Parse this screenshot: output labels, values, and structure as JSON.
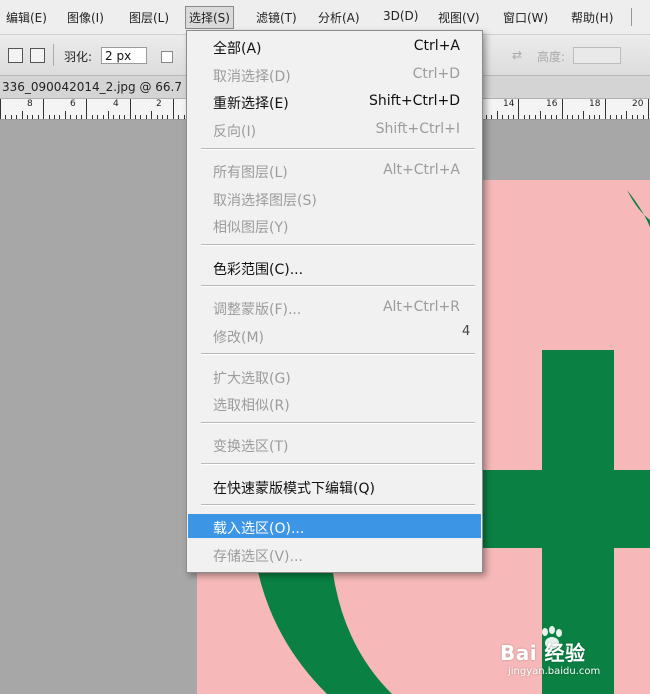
{
  "menubar": {
    "items": [
      "编辑(E)",
      "图像(I)",
      "图层(L)",
      "选择(S)",
      "滤镜(T)",
      "分析(A)",
      "3D(D)",
      "视图(V)",
      "窗口(W)",
      "帮助(H)"
    ]
  },
  "options": {
    "feather_label": "羽化:",
    "feather_value": "2 px",
    "height_label": "高度:",
    "swap_glyph": "⇄"
  },
  "document": {
    "tab_title": "336_090042014_2.jpg @ 66.7"
  },
  "ruler": {
    "labels": [
      "8",
      "6",
      "4",
      "2",
      "14",
      "16",
      "18",
      "20"
    ]
  },
  "select_menu": {
    "items": [
      {
        "label": "全部(A)",
        "shortcut": "Ctrl+A"
      },
      {
        "label": "取消选择(D)",
        "shortcut": "Ctrl+D"
      },
      {
        "label": "重新选择(E)",
        "shortcut": "Shift+Ctrl+D"
      },
      {
        "label": "反向(I)",
        "shortcut": "Shift+Ctrl+I"
      },
      {
        "label": "所有图层(L)",
        "shortcut": "Alt+Ctrl+A"
      },
      {
        "label": "取消选择图层(S)",
        "shortcut": ""
      },
      {
        "label": "相似图层(Y)",
        "shortcut": ""
      },
      {
        "label": "色彩范围(C)...",
        "shortcut": ""
      },
      {
        "label": "调整蒙版(F)...",
        "shortcut": "Alt+Ctrl+R"
      },
      {
        "label": "修改(M)",
        "shortcut": ""
      },
      {
        "label": "扩大选取(G)",
        "shortcut": ""
      },
      {
        "label": "选取相似(R)",
        "shortcut": ""
      },
      {
        "label": "变换选区(T)",
        "shortcut": ""
      },
      {
        "label": "在快速蒙版模式下编辑(Q)",
        "shortcut": ""
      },
      {
        "label": "载入选区(O)...",
        "shortcut": ""
      },
      {
        "label": "存储选区(V)...",
        "shortcut": ""
      }
    ],
    "annotation": "4"
  },
  "colors": {
    "highlight": "#3d95e6",
    "canvas_pink": "#f6b8b8",
    "glyph_green": "#0a8043"
  },
  "watermark": {
    "text": "Bai 经验",
    "url": "jingyan.baidu.com"
  }
}
